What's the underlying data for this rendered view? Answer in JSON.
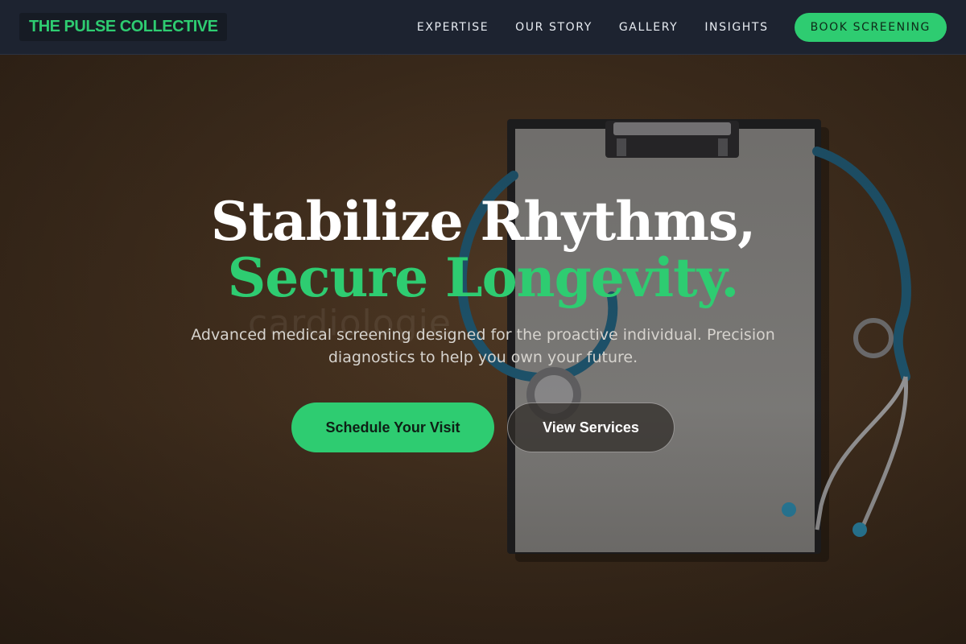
{
  "brand": {
    "name": "THE PULSE COLLECTIVE",
    "accent": "#2ecc71"
  },
  "nav": {
    "links": [
      "EXPERTISE",
      "OUR STORY",
      "GALLERY",
      "INSIGHTS"
    ],
    "cta": "BOOK SCREENING"
  },
  "hero": {
    "headline_line1": "Stabilize Rhythms,",
    "headline_line2": "Secure Longevity.",
    "subheadline": "Advanced medical screening designed for the proactive individual. Precision diagnostics to help you own your future.",
    "primary_button": "Schedule Your Visit",
    "secondary_button": "View Services",
    "watermark": "cardiologie",
    "background_image": "clipboard-and-stethoscope-photo"
  }
}
